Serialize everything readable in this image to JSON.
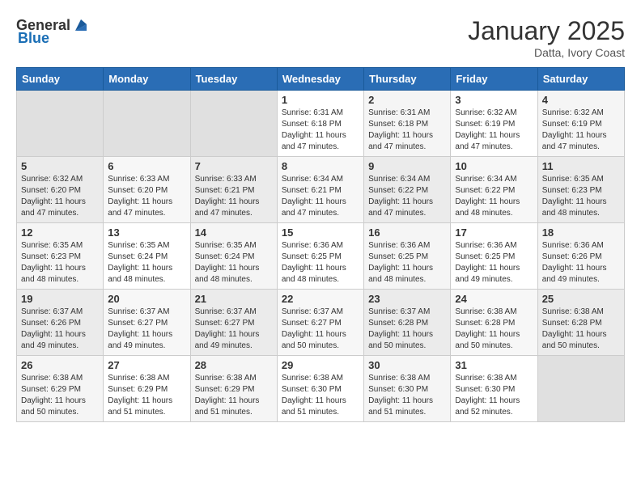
{
  "logo": {
    "general": "General",
    "blue": "Blue"
  },
  "title": "January 2025",
  "location": "Datta, Ivory Coast",
  "headers": [
    "Sunday",
    "Monday",
    "Tuesday",
    "Wednesday",
    "Thursday",
    "Friday",
    "Saturday"
  ],
  "weeks": [
    [
      {
        "day": "",
        "sunrise": "",
        "sunset": "",
        "daylight": ""
      },
      {
        "day": "",
        "sunrise": "",
        "sunset": "",
        "daylight": ""
      },
      {
        "day": "",
        "sunrise": "",
        "sunset": "",
        "daylight": ""
      },
      {
        "day": "1",
        "sunrise": "Sunrise: 6:31 AM",
        "sunset": "Sunset: 6:18 PM",
        "daylight": "Daylight: 11 hours and 47 minutes."
      },
      {
        "day": "2",
        "sunrise": "Sunrise: 6:31 AM",
        "sunset": "Sunset: 6:18 PM",
        "daylight": "Daylight: 11 hours and 47 minutes."
      },
      {
        "day": "3",
        "sunrise": "Sunrise: 6:32 AM",
        "sunset": "Sunset: 6:19 PM",
        "daylight": "Daylight: 11 hours and 47 minutes."
      },
      {
        "day": "4",
        "sunrise": "Sunrise: 6:32 AM",
        "sunset": "Sunset: 6:19 PM",
        "daylight": "Daylight: 11 hours and 47 minutes."
      }
    ],
    [
      {
        "day": "5",
        "sunrise": "Sunrise: 6:32 AM",
        "sunset": "Sunset: 6:20 PM",
        "daylight": "Daylight: 11 hours and 47 minutes."
      },
      {
        "day": "6",
        "sunrise": "Sunrise: 6:33 AM",
        "sunset": "Sunset: 6:20 PM",
        "daylight": "Daylight: 11 hours and 47 minutes."
      },
      {
        "day": "7",
        "sunrise": "Sunrise: 6:33 AM",
        "sunset": "Sunset: 6:21 PM",
        "daylight": "Daylight: 11 hours and 47 minutes."
      },
      {
        "day": "8",
        "sunrise": "Sunrise: 6:34 AM",
        "sunset": "Sunset: 6:21 PM",
        "daylight": "Daylight: 11 hours and 47 minutes."
      },
      {
        "day": "9",
        "sunrise": "Sunrise: 6:34 AM",
        "sunset": "Sunset: 6:22 PM",
        "daylight": "Daylight: 11 hours and 47 minutes."
      },
      {
        "day": "10",
        "sunrise": "Sunrise: 6:34 AM",
        "sunset": "Sunset: 6:22 PM",
        "daylight": "Daylight: 11 hours and 48 minutes."
      },
      {
        "day": "11",
        "sunrise": "Sunrise: 6:35 AM",
        "sunset": "Sunset: 6:23 PM",
        "daylight": "Daylight: 11 hours and 48 minutes."
      }
    ],
    [
      {
        "day": "12",
        "sunrise": "Sunrise: 6:35 AM",
        "sunset": "Sunset: 6:23 PM",
        "daylight": "Daylight: 11 hours and 48 minutes."
      },
      {
        "day": "13",
        "sunrise": "Sunrise: 6:35 AM",
        "sunset": "Sunset: 6:24 PM",
        "daylight": "Daylight: 11 hours and 48 minutes."
      },
      {
        "day": "14",
        "sunrise": "Sunrise: 6:35 AM",
        "sunset": "Sunset: 6:24 PM",
        "daylight": "Daylight: 11 hours and 48 minutes."
      },
      {
        "day": "15",
        "sunrise": "Sunrise: 6:36 AM",
        "sunset": "Sunset: 6:25 PM",
        "daylight": "Daylight: 11 hours and 48 minutes."
      },
      {
        "day": "16",
        "sunrise": "Sunrise: 6:36 AM",
        "sunset": "Sunset: 6:25 PM",
        "daylight": "Daylight: 11 hours and 48 minutes."
      },
      {
        "day": "17",
        "sunrise": "Sunrise: 6:36 AM",
        "sunset": "Sunset: 6:25 PM",
        "daylight": "Daylight: 11 hours and 49 minutes."
      },
      {
        "day": "18",
        "sunrise": "Sunrise: 6:36 AM",
        "sunset": "Sunset: 6:26 PM",
        "daylight": "Daylight: 11 hours and 49 minutes."
      }
    ],
    [
      {
        "day": "19",
        "sunrise": "Sunrise: 6:37 AM",
        "sunset": "Sunset: 6:26 PM",
        "daylight": "Daylight: 11 hours and 49 minutes."
      },
      {
        "day": "20",
        "sunrise": "Sunrise: 6:37 AM",
        "sunset": "Sunset: 6:27 PM",
        "daylight": "Daylight: 11 hours and 49 minutes."
      },
      {
        "day": "21",
        "sunrise": "Sunrise: 6:37 AM",
        "sunset": "Sunset: 6:27 PM",
        "daylight": "Daylight: 11 hours and 49 minutes."
      },
      {
        "day": "22",
        "sunrise": "Sunrise: 6:37 AM",
        "sunset": "Sunset: 6:27 PM",
        "daylight": "Daylight: 11 hours and 50 minutes."
      },
      {
        "day": "23",
        "sunrise": "Sunrise: 6:37 AM",
        "sunset": "Sunset: 6:28 PM",
        "daylight": "Daylight: 11 hours and 50 minutes."
      },
      {
        "day": "24",
        "sunrise": "Sunrise: 6:38 AM",
        "sunset": "Sunset: 6:28 PM",
        "daylight": "Daylight: 11 hours and 50 minutes."
      },
      {
        "day": "25",
        "sunrise": "Sunrise: 6:38 AM",
        "sunset": "Sunset: 6:28 PM",
        "daylight": "Daylight: 11 hours and 50 minutes."
      }
    ],
    [
      {
        "day": "26",
        "sunrise": "Sunrise: 6:38 AM",
        "sunset": "Sunset: 6:29 PM",
        "daylight": "Daylight: 11 hours and 50 minutes."
      },
      {
        "day": "27",
        "sunrise": "Sunrise: 6:38 AM",
        "sunset": "Sunset: 6:29 PM",
        "daylight": "Daylight: 11 hours and 51 minutes."
      },
      {
        "day": "28",
        "sunrise": "Sunrise: 6:38 AM",
        "sunset": "Sunset: 6:29 PM",
        "daylight": "Daylight: 11 hours and 51 minutes."
      },
      {
        "day": "29",
        "sunrise": "Sunrise: 6:38 AM",
        "sunset": "Sunset: 6:30 PM",
        "daylight": "Daylight: 11 hours and 51 minutes."
      },
      {
        "day": "30",
        "sunrise": "Sunrise: 6:38 AM",
        "sunset": "Sunset: 6:30 PM",
        "daylight": "Daylight: 11 hours and 51 minutes."
      },
      {
        "day": "31",
        "sunrise": "Sunrise: 6:38 AM",
        "sunset": "Sunset: 6:30 PM",
        "daylight": "Daylight: 11 hours and 52 minutes."
      },
      {
        "day": "",
        "sunrise": "",
        "sunset": "",
        "daylight": ""
      }
    ]
  ]
}
